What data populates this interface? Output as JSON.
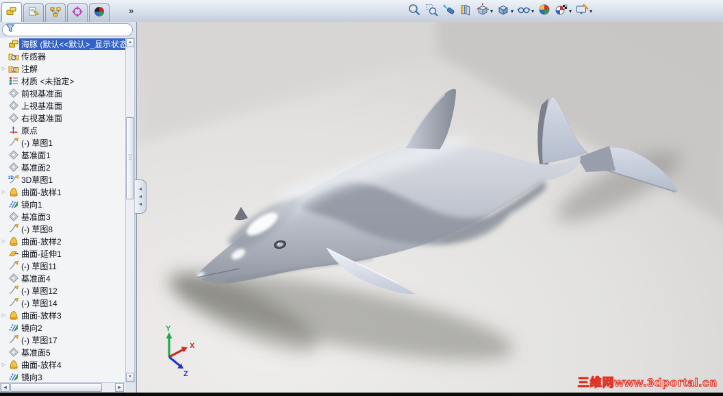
{
  "app": {
    "title": "SolidWorks part document"
  },
  "feature_manager": {
    "tabs": [
      {
        "name": "features-tree",
        "active": true
      },
      {
        "name": "property-manager",
        "active": false
      },
      {
        "name": "configuration-manager",
        "active": false
      },
      {
        "name": "dimxpert-manager",
        "active": false
      },
      {
        "name": "display-manager",
        "active": false
      }
    ],
    "overflow_chevron": "»",
    "filter": {
      "value": "",
      "placeholder": ""
    },
    "tree": {
      "root": {
        "icon": "part",
        "label": "海豚 (默认<<默认>_显示状态",
        "selected": true
      },
      "items": [
        {
          "icon": "sensors",
          "label": "传感器",
          "expandable": false
        },
        {
          "icon": "annotations",
          "label": "注解",
          "expandable": true
        },
        {
          "icon": "material",
          "label": "材质 <未指定>",
          "expandable": false
        },
        {
          "icon": "plane",
          "label": "前视基准面",
          "expandable": false
        },
        {
          "icon": "plane",
          "label": "上视基准面",
          "expandable": false
        },
        {
          "icon": "plane",
          "label": "右视基准面",
          "expandable": false
        },
        {
          "icon": "origin",
          "label": "原点",
          "expandable": false
        },
        {
          "icon": "sketch",
          "label": "(-) 草图1",
          "expandable": false
        },
        {
          "icon": "plane",
          "label": "基准面1",
          "expandable": false
        },
        {
          "icon": "plane",
          "label": "基准面2",
          "expandable": false
        },
        {
          "icon": "sketch3d",
          "label": "3D草图1",
          "expandable": false
        },
        {
          "icon": "loft",
          "label": "曲面-放样1",
          "expandable": true
        },
        {
          "icon": "mirror",
          "label": "镜向1",
          "expandable": false
        },
        {
          "icon": "plane",
          "label": "基准面3",
          "expandable": false
        },
        {
          "icon": "sketch",
          "label": "(-) 草图8",
          "expandable": false
        },
        {
          "icon": "loft",
          "label": "曲面-放样2",
          "expandable": true
        },
        {
          "icon": "extend",
          "label": "曲面-延伸1",
          "expandable": false
        },
        {
          "icon": "sketch",
          "label": "(-) 草图11",
          "expandable": false
        },
        {
          "icon": "plane",
          "label": "基准面4",
          "expandable": false
        },
        {
          "icon": "sketch",
          "label": "(-) 草图12",
          "expandable": false
        },
        {
          "icon": "sketch",
          "label": "(-) 草图14",
          "expandable": false
        },
        {
          "icon": "loft",
          "label": "曲面-放样3",
          "expandable": true
        },
        {
          "icon": "mirror",
          "label": "镜向2",
          "expandable": false
        },
        {
          "icon": "sketch",
          "label": "(-) 草图17",
          "expandable": false
        },
        {
          "icon": "plane",
          "label": "基准面5",
          "expandable": false
        },
        {
          "icon": "loft",
          "label": "曲面-放样4",
          "expandable": true
        },
        {
          "icon": "mirror",
          "label": "镜向3",
          "expandable": false
        }
      ]
    }
  },
  "heads_up_toolbar": {
    "buttons": [
      {
        "name": "zoom-fit",
        "dropdown": false
      },
      {
        "name": "zoom-area",
        "dropdown": false
      },
      {
        "name": "previous-view",
        "dropdown": false
      },
      {
        "name": "section-view",
        "dropdown": false
      },
      {
        "name": "view-orientation",
        "dropdown": true
      },
      {
        "name": "display-style",
        "dropdown": true
      },
      {
        "name": "hide-show-items",
        "dropdown": true
      },
      {
        "name": "apply-scene",
        "dropdown": false
      },
      {
        "name": "view-settings",
        "dropdown": true
      },
      {
        "name": "edit-appearance",
        "dropdown": true
      }
    ]
  },
  "viewport": {
    "model_name": "海豚 (dolphin surface model)",
    "triad": {
      "x_label": "X",
      "y_label": "Y",
      "z_label": "Z",
      "x_color": "#cc2a1e",
      "y_color": "#1faa4a",
      "z_color": "#2335cc"
    },
    "watermark": "三维网www.3dportal.cn"
  },
  "colors": {
    "selection": "#3261c8",
    "watermark_red": "#e03326",
    "chrome": "#ccd5e2"
  }
}
